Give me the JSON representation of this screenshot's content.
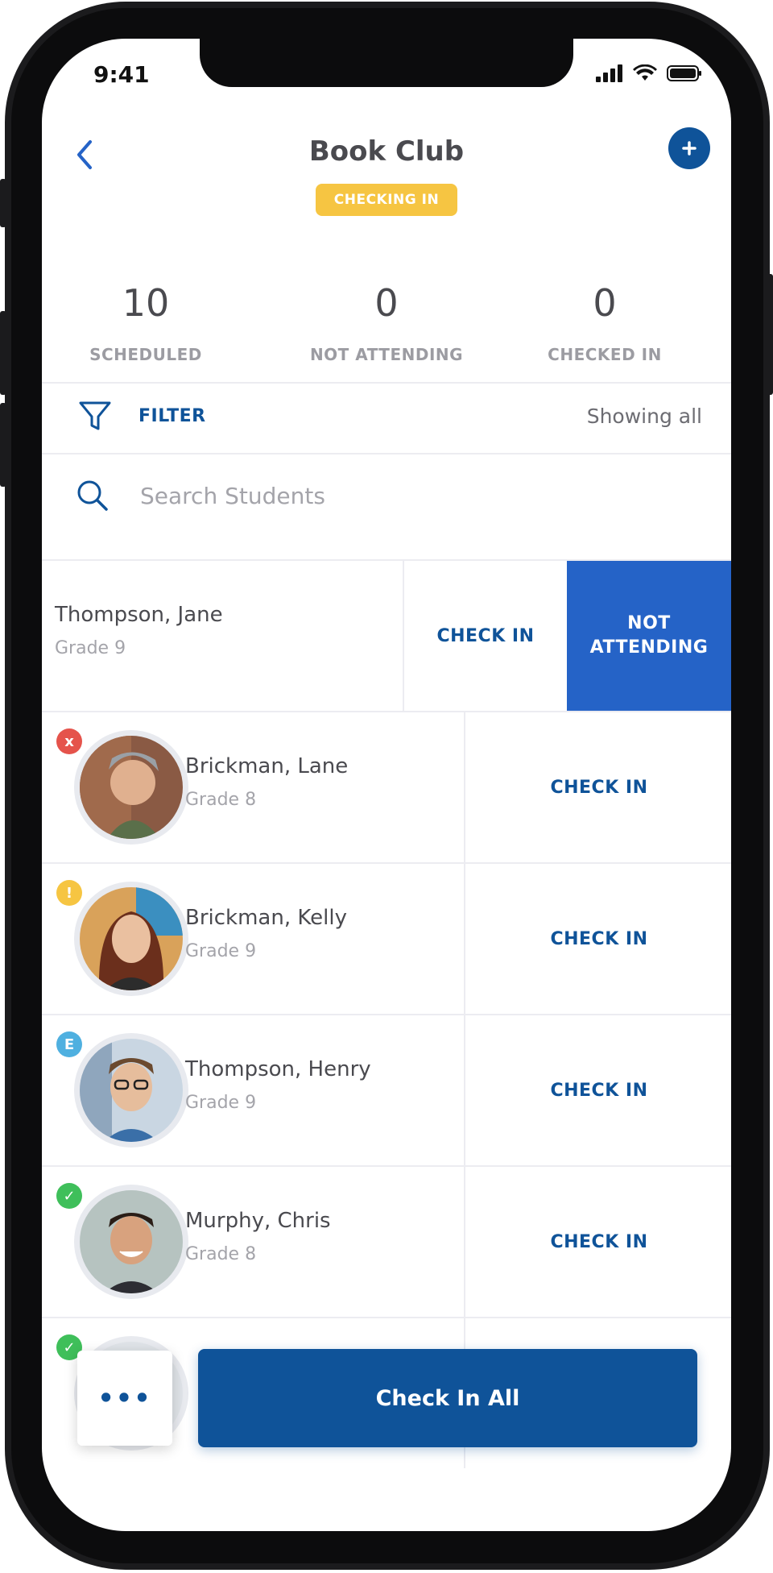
{
  "status_bar": {
    "time": "9:41"
  },
  "header": {
    "title": "Book Club",
    "badge": "CHECKING IN"
  },
  "stats": [
    {
      "value": "10",
      "label": "SCHEDULED"
    },
    {
      "value": "0",
      "label": "NOT ATTENDING"
    },
    {
      "value": "0",
      "label": "CHECKED IN"
    }
  ],
  "filter": {
    "label": "FILTER",
    "status": "Showing all"
  },
  "search": {
    "placeholder": "Search Students",
    "value": ""
  },
  "swiped_student": {
    "name": "Thompson, Jane",
    "grade": "Grade 9",
    "check_in_label": "CHECK IN",
    "not_attending_label": "NOT\nATTENDING"
  },
  "students": [
    {
      "name": "Brickman, Lane",
      "grade": "Grade 8",
      "action": "CHECK IN",
      "status": "x",
      "status_color": "#e5534b"
    },
    {
      "name": "Brickman, Kelly",
      "grade": "Grade 9",
      "action": "CHECK IN",
      "status": "!",
      "status_color": "#f6c542"
    },
    {
      "name": "Thompson, Henry",
      "grade": "Grade 9",
      "action": "CHECK IN",
      "status": "E",
      "status_color": "#4fb0e0"
    },
    {
      "name": "Murphy, Chris",
      "grade": "Grade 8",
      "action": "CHECK IN",
      "status": "✓",
      "status_color": "#3fbf5a"
    },
    {
      "status": "✓",
      "status_color": "#3fbf5a"
    }
  ],
  "bottom": {
    "more_label": "•••",
    "check_in_all_label": "Check In All"
  },
  "colors": {
    "primary": "#0f5399",
    "swipe_action": "#2563c7",
    "badge": "#f6c542"
  }
}
